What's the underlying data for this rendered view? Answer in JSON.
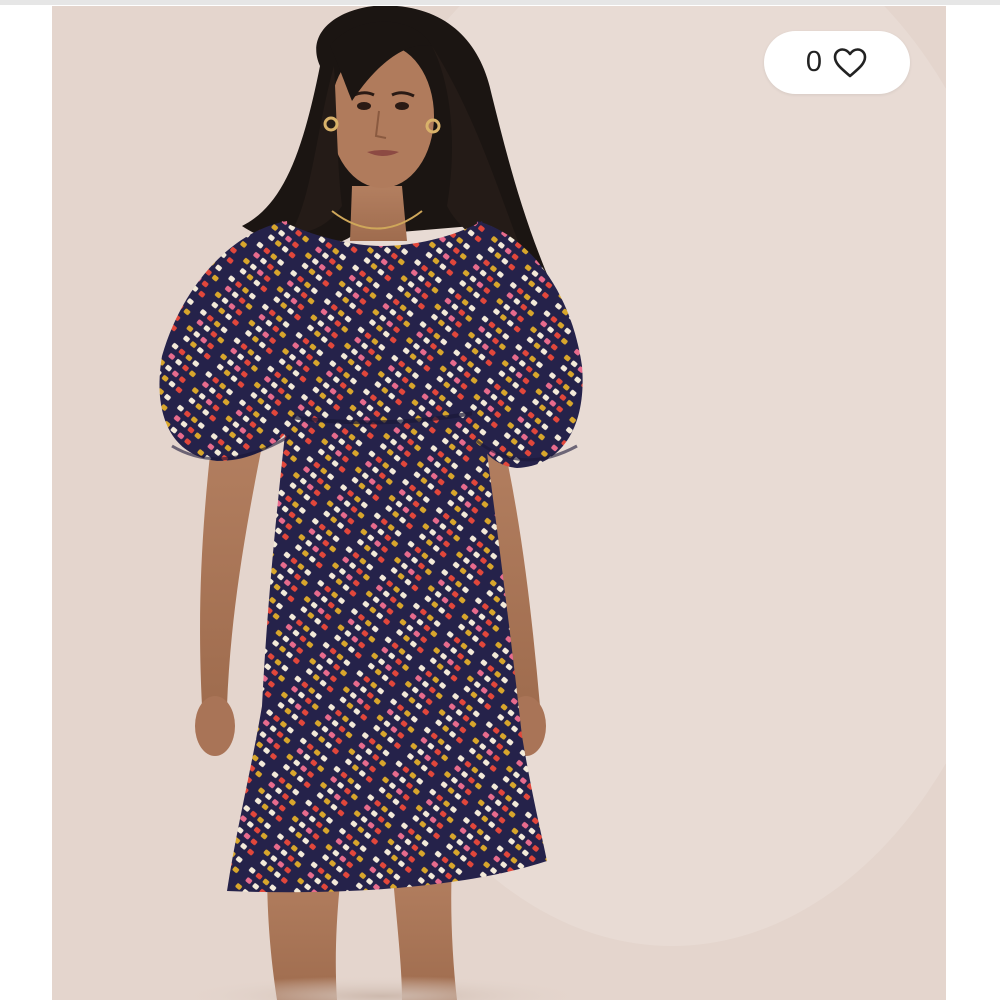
{
  "product": {
    "image_description_icon": "model-wearing-patterned-dress-photo"
  },
  "favorite": {
    "count": "0",
    "icon": "heart-outline-icon"
  },
  "colors": {
    "backdrop": "#e4d5cd",
    "dress_navy": "#25224a",
    "dress_red": "#e2473b",
    "dress_mustard": "#d8a62c",
    "dress_cream": "#f3ead9",
    "dress_pink": "#e86b8d"
  }
}
